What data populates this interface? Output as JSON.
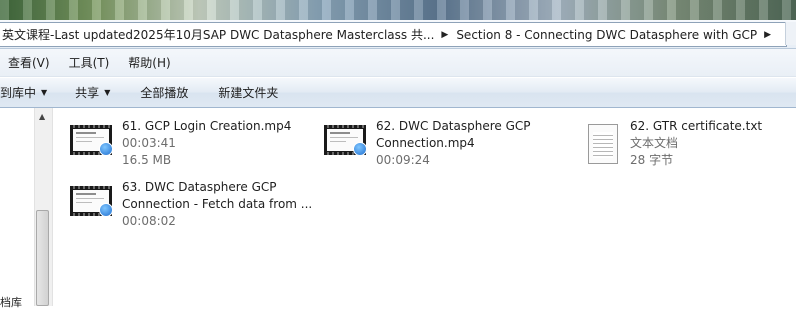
{
  "address": {
    "segment1": "英文课程-Last updated2025年10月SAP DWC Datasphere Masterclass  共...",
    "segment2": "Section 8 - Connecting DWC Datasphere with GCP"
  },
  "menu": [
    "查看(V)",
    "工具(T)",
    "帮助(H)"
  ],
  "toolbar": {
    "include_library": "到库中",
    "share": "共享",
    "play_all": "全部播放",
    "new_folder": "新建文件夹"
  },
  "left_pane": {
    "partial_label": "档库"
  },
  "files": [
    {
      "name": "61. GCP Login Creation.mp4",
      "line2": "00:03:41",
      "line3": "16.5 MB",
      "icon": "video-file-icon"
    },
    {
      "name": "62. DWC Datasphere GCP",
      "name2": "Connection.mp4",
      "line2": "00:09:24",
      "icon": "video-file-icon"
    },
    {
      "name": "62. GTR certificate.txt",
      "line2": "文本文档",
      "line3": "28 字节",
      "icon": "text-document-icon"
    },
    {
      "name": "63. DWC Datasphere GCP",
      "name2": "Connection - Fetch data from ...",
      "line2": "00:08:02",
      "icon": "video-file-icon"
    }
  ]
}
